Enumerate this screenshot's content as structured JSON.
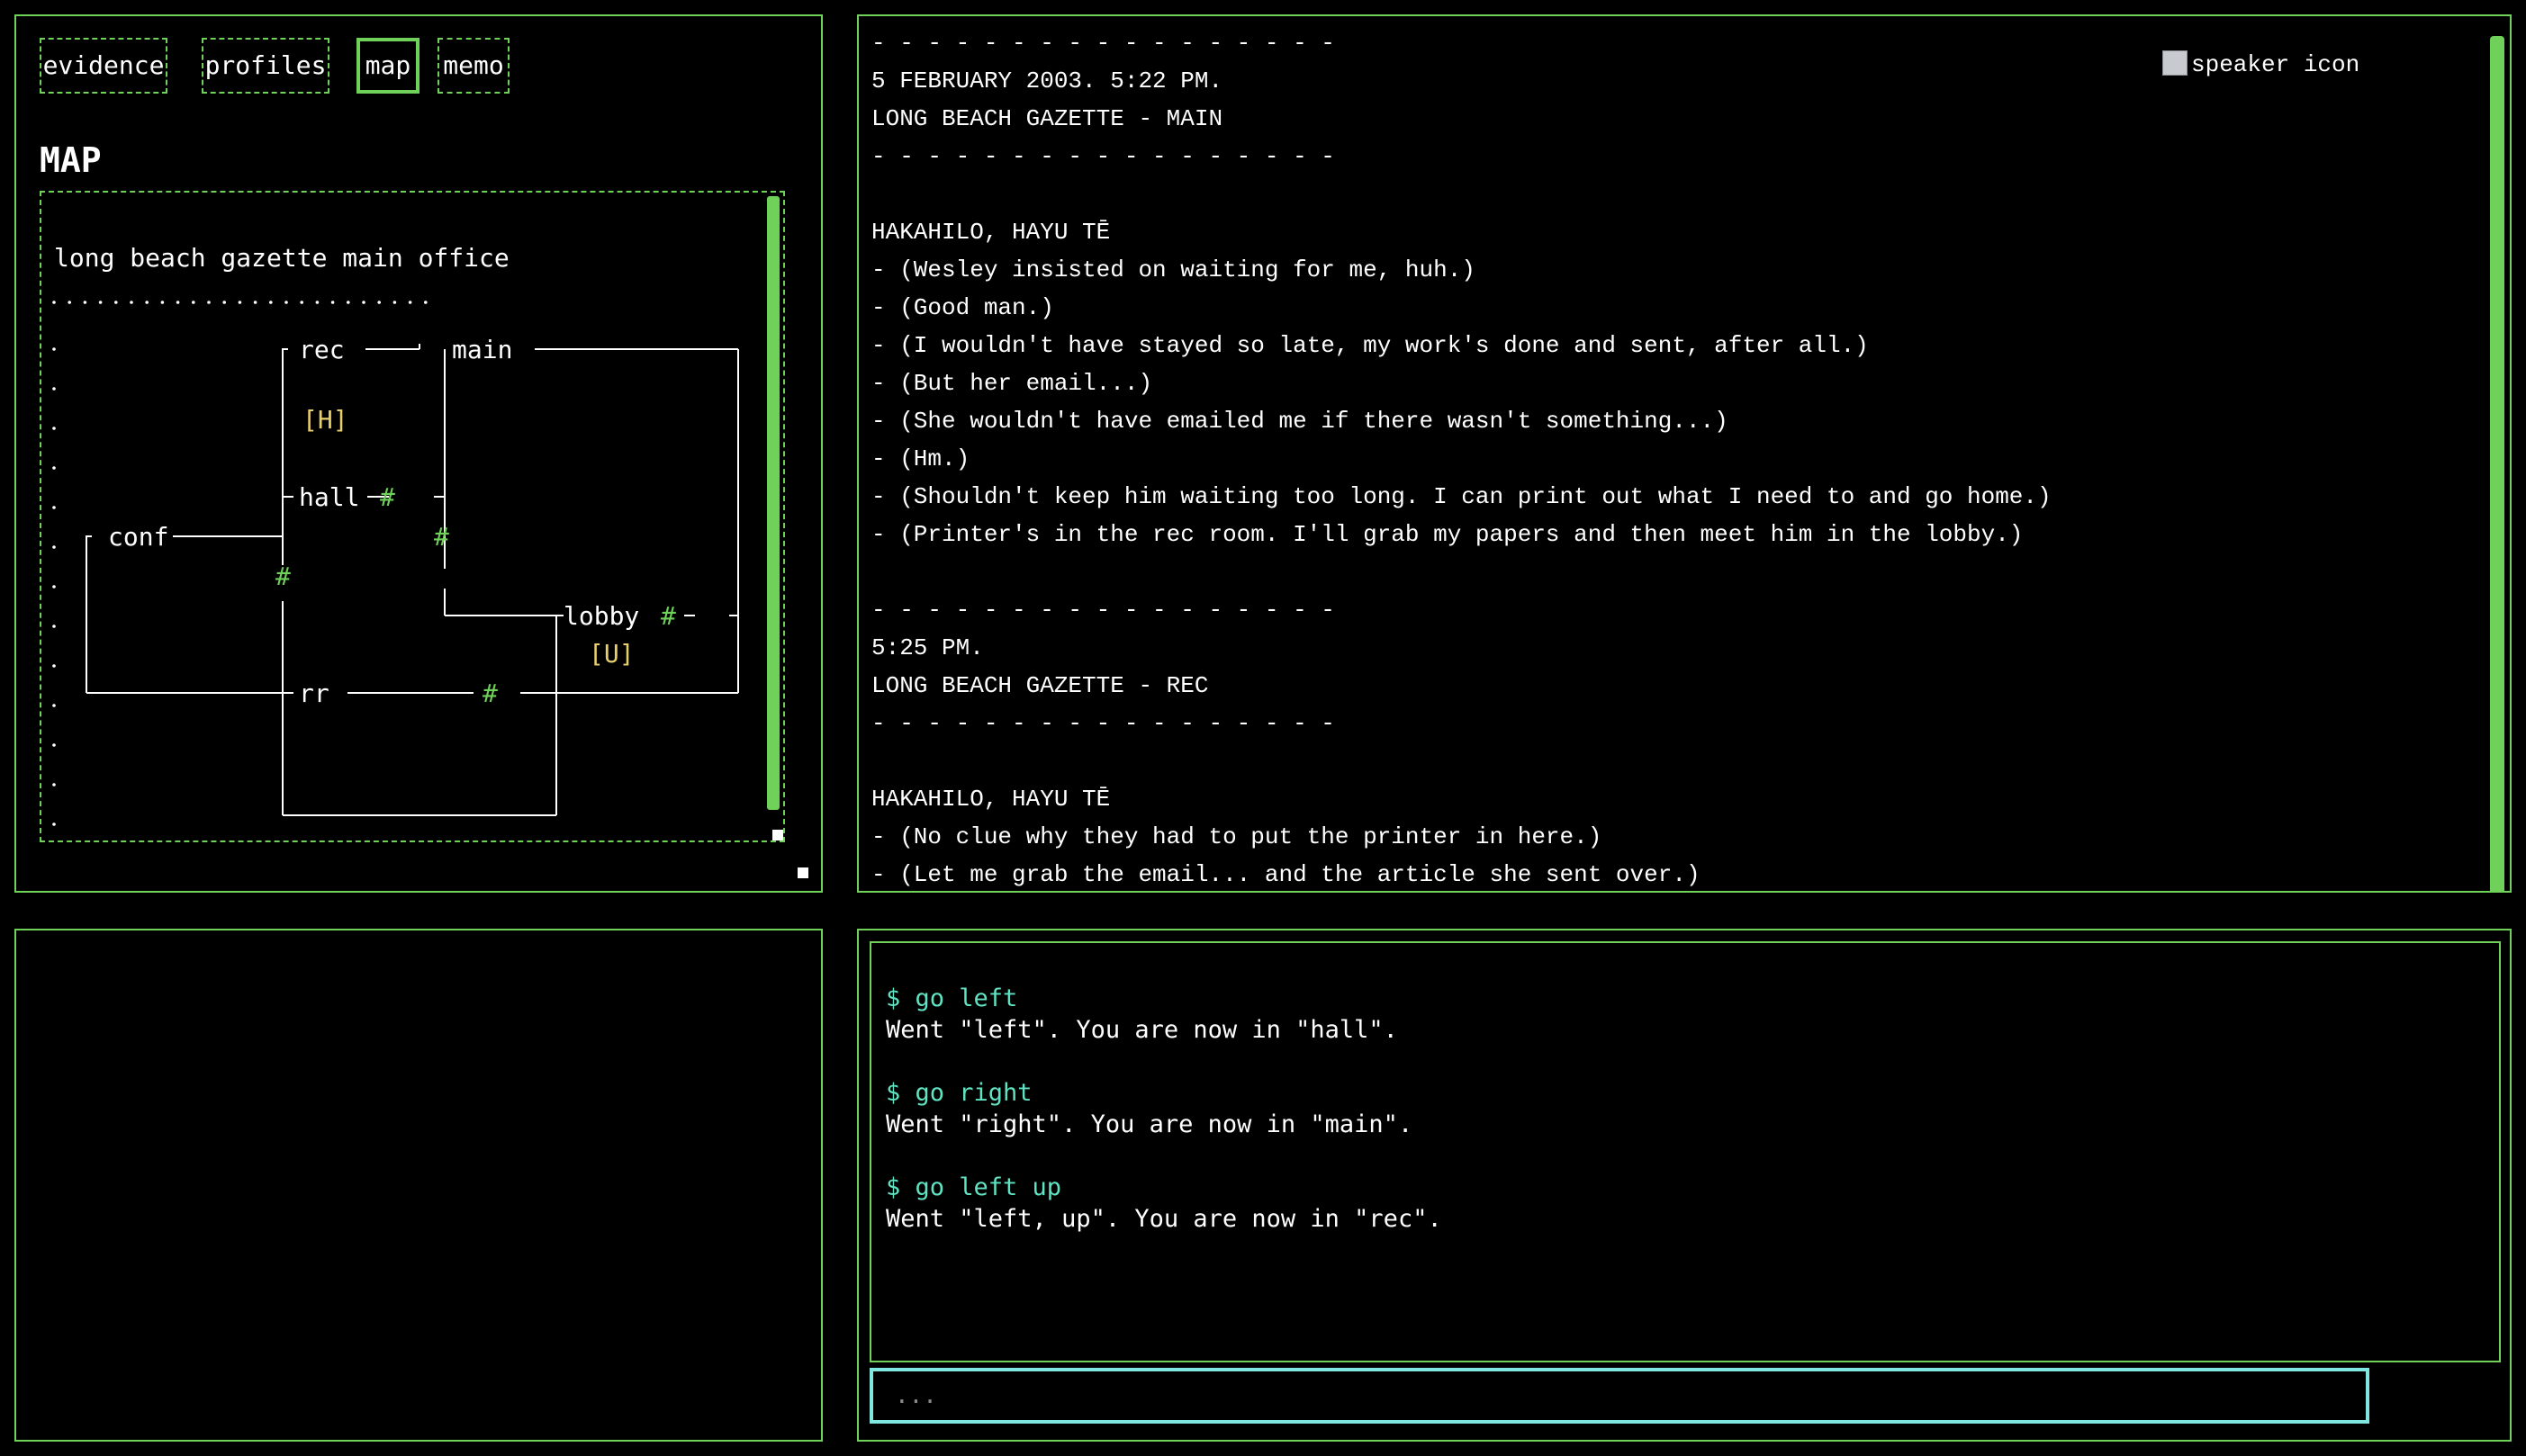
{
  "colors": {
    "border": "#6fd05a",
    "accent_green": "#6fd05a",
    "yellow": "#e7cf6c",
    "command": "#5fe3c2",
    "input_border": "#7fe6e0",
    "background": "#000000",
    "text": "#ffffff"
  },
  "tabs": {
    "evidence": "evidence",
    "profiles": "profiles",
    "map": "map",
    "memo": "memo",
    "active": "map"
  },
  "map": {
    "heading": "MAP",
    "title": "long beach gazette main office",
    "rooms": {
      "rec": "rec",
      "main": "main",
      "hall": "hall",
      "conf": "conf",
      "lobby": "lobby",
      "rr": "rr"
    },
    "markers": {
      "hayu": "[H]",
      "unknown": "[U]"
    },
    "door": "#",
    "dot": "."
  },
  "log": {
    "separator": "- - - - - - - - - - - - - - - - -",
    "speaker_alt": "speaker icon",
    "lines": [
      "- - - - - - - - - - - - - - - - -",
      "5 FEBRUARY 2003. 5:22 PM.",
      "LONG BEACH GAZETTE - MAIN",
      "- - - - - - - - - - - - - - - - -",
      "",
      "HAKAHILO, HAYU TĒ",
      "- (Wesley insisted on waiting for me, huh.)",
      "- (Good man.)",
      "- (I wouldn't have stayed so late, my work's done and sent, after all.)",
      "- (But her email...)",
      "- (She wouldn't have emailed me if there wasn't something...)",
      "- (Hm.)",
      "- (Shouldn't keep him waiting too long. I can print out what I need to and go home.)",
      "- (Printer's in the rec room. I'll grab my papers and then meet him in the lobby.)",
      "",
      "- - - - - - - - - - - - - - - - -",
      "5:25 PM.",
      "LONG BEACH GAZETTE - REC",
      "- - - - - - - - - - - - - - - - -",
      "",
      "HAKAHILO, HAYU TĒ",
      "- (No clue why they had to put the printer in here.)",
      "- (Let me grab the email... and the article she sent over.)"
    ]
  },
  "terminal": {
    "history": [
      {
        "command": "$ go left",
        "output": "Went \"left\". You are now in \"hall\"."
      },
      {
        "command": "$ go right",
        "output": "Went \"right\". You are now in \"main\"."
      },
      {
        "command": "$ go left up",
        "output": "Went \"left, up\". You are now in \"rec\"."
      }
    ],
    "input_placeholder": "...",
    "input_value": ""
  }
}
